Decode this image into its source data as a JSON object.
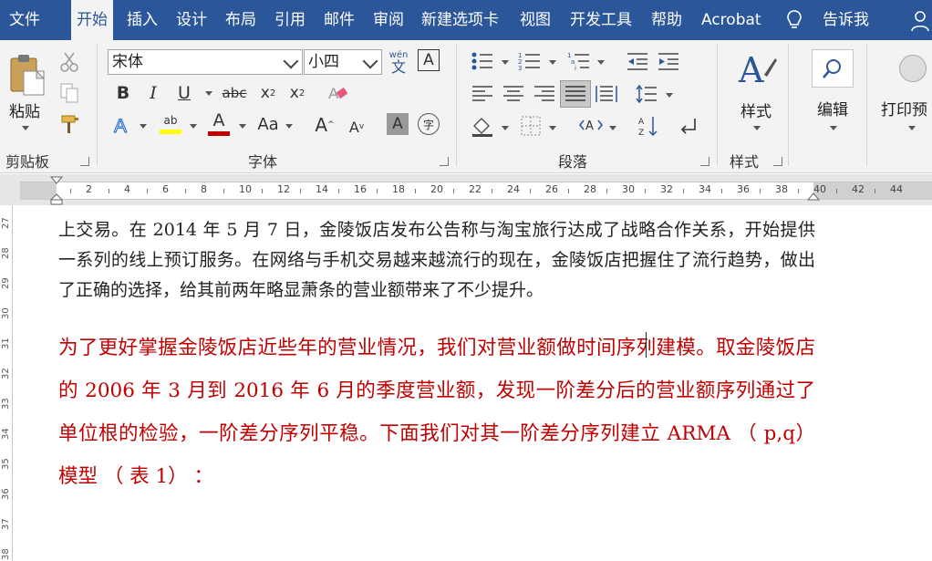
{
  "tabs": [
    {
      "label": "文件"
    },
    {
      "label": "开始"
    },
    {
      "label": "插入"
    },
    {
      "label": "设计"
    },
    {
      "label": "布局"
    },
    {
      "label": "引用"
    },
    {
      "label": "邮件"
    },
    {
      "label": "审阅"
    },
    {
      "label": "新建选项卡"
    },
    {
      "label": "视图"
    },
    {
      "label": "开发工具"
    },
    {
      "label": "帮助"
    },
    {
      "label": "Acrobat"
    }
  ],
  "tellme": "告诉我",
  "clipboard": {
    "paste": "粘贴",
    "group": "剪贴板"
  },
  "font": {
    "name": "宋体",
    "size": "小四",
    "phonetic_top": "wén",
    "phonetic_bottom": "文",
    "group": "字体",
    "char_a": "A",
    "clear_format": "A",
    "aa": "Aa",
    "grow": "A",
    "shrink": "A",
    "shade": "A",
    "enclose": "字"
  },
  "paragraph": {
    "group": "段落"
  },
  "styles": {
    "label": "样式",
    "group": "样式"
  },
  "editing": {
    "label": "编辑"
  },
  "print": {
    "label": "打印预"
  },
  "ruler": {
    "numbers": [
      "2",
      "4",
      "6",
      "8",
      "10",
      "12",
      "14",
      "16",
      "18",
      "20",
      "22",
      "24",
      "26",
      "28",
      "30",
      "32",
      "34",
      "36",
      "38",
      "40",
      "42",
      "44"
    ]
  },
  "vruler": {
    "numbers": [
      "27",
      "28",
      "29",
      "30",
      "31",
      "32",
      "33",
      "34",
      "35",
      "36",
      "37",
      "38"
    ]
  },
  "document": {
    "para1": "上交易。在 2014 年 5 月 7 日，金陵饭店发布公告称与淘宝旅行达成了战略合作关系，开始提供一系列的线上预订服务。在网络与手机交易越来越流行的现在，金陵饭店把握住了流行趋势，做出了正确的选择，给其前两年略显萧条的营业额带来了不少提升。",
    "para2": "为了更好掌握金陵饭店近些年的营业情况，我们对营业额做时间序列建模。取金陵饭店的 2006 年 3 月到 2016 年 6 月的季度营业额，发现一阶差分后的营业额序列通过了单位根的检验，一阶差分序列平稳。下面我们对其一阶差分序列建立 ARMA （ p,q） 模型 （ 表 1） ："
  }
}
